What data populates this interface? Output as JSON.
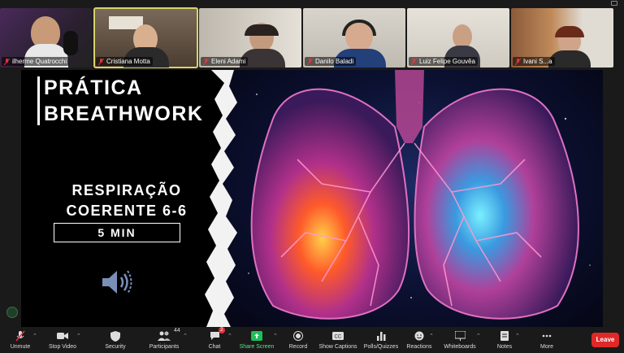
{
  "participants": [
    {
      "name": "ilherme Quatrocchi",
      "active": false,
      "bg": "#3a2a4a"
    },
    {
      "name": "Cristiana Motta",
      "active": true,
      "bg": "#5a4638"
    },
    {
      "name": "Eleni Adami",
      "active": false,
      "bg": "#d9d4cc"
    },
    {
      "name": "Danilo Baladi",
      "active": false,
      "bg": "#cfcac0"
    },
    {
      "name": "Luiz Felipe Gouvêa",
      "active": false,
      "bg": "#c8c4ba"
    },
    {
      "name": "Ivani S...a",
      "active": false,
      "bg": "#8a5a3a"
    }
  ],
  "slide": {
    "title_line1": "PRÁTICA",
    "title_line2": "BREATHWORK",
    "subtitle_line1": "RESPIRAÇÃO",
    "subtitle_line2": "COERENTE 6-6",
    "duration": "5 MIN"
  },
  "toolbar": {
    "unmute": "Unmute",
    "stop_video": "Stop Video",
    "security": "Security",
    "participants": "Participants",
    "participants_count": "44",
    "chat": "Chat",
    "chat_badge": "2",
    "share_screen": "Share Screen",
    "record": "Record",
    "show_captions": "Show Captions",
    "polls": "Polls/Quizzes",
    "reactions": "Reactions",
    "whiteboards": "Whiteboards",
    "notes": "Notes",
    "more": "More",
    "leave": "Leave"
  },
  "colors": {
    "leave": "#e02828",
    "share_screen": "#1fbf5a",
    "active_speaker": "#d8d36a",
    "muted_mic": "#e8323c"
  }
}
